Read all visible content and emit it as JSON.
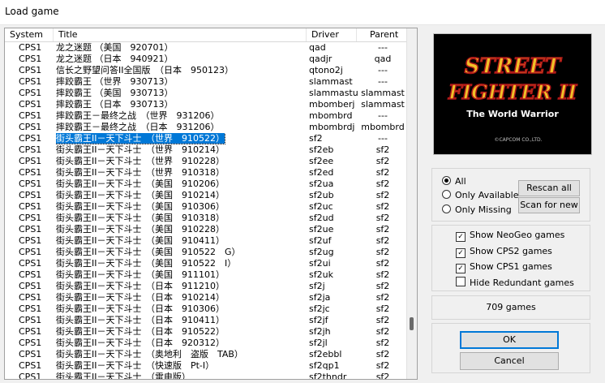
{
  "window": {
    "title": "Load game"
  },
  "columns": [
    "System",
    "Title",
    "Driver",
    "Parent"
  ],
  "rows": [
    [
      "CPS1",
      "龙之迷题 （美国　920701）",
      "qad",
      "---"
    ],
    [
      "CPS1",
      "龙之迷题 （日本　940921）",
      "qadjr",
      "qad"
    ],
    [
      "CPS1",
      "信长之野望问答II全国版　（日本　950123）",
      "qtono2j",
      "---"
    ],
    [
      "CPS1",
      "摔跤霸王 （世界　930713）",
      "slammast",
      "---"
    ],
    [
      "CPS1",
      "摔跤霸王 （美国　930713）",
      "slammastu",
      "slammast"
    ],
    [
      "CPS1",
      "摔跤霸王 （日本　930713）",
      "mbomberj",
      "slammast"
    ],
    [
      "CPS1",
      "摔跤霸王－最终之战　（世界　931206）",
      "mbombrd",
      "---"
    ],
    [
      "CPS1",
      "摔跤霸王－最终之战　（日本　931206）",
      "mbombrdj",
      "mbombrd"
    ],
    [
      "CPS1",
      "街头霸王II－天下斗士　（世界　910522）",
      "sf2",
      "---"
    ],
    [
      "CPS1",
      "街头霸王II－天下斗士　（世界　910214）",
      "sf2eb",
      "sf2"
    ],
    [
      "CPS1",
      "街头霸王II－天下斗士　（世界　910228）",
      "sf2ee",
      "sf2"
    ],
    [
      "CPS1",
      "街头霸王II－天下斗士　（世界　910318）",
      "sf2ed",
      "sf2"
    ],
    [
      "CPS1",
      "街头霸王II－天下斗士　（美国　910206）",
      "sf2ua",
      "sf2"
    ],
    [
      "CPS1",
      "街头霸王II－天下斗士　（美国　910214）",
      "sf2ub",
      "sf2"
    ],
    [
      "CPS1",
      "街头霸王II－天下斗士　（美国　910306）",
      "sf2uc",
      "sf2"
    ],
    [
      "CPS1",
      "街头霸王II－天下斗士　（美国　910318）",
      "sf2ud",
      "sf2"
    ],
    [
      "CPS1",
      "街头霸王II－天下斗士　（美国　910228）",
      "sf2ue",
      "sf2"
    ],
    [
      "CPS1",
      "街头霸王II－天下斗士　（美国　910411）",
      "sf2uf",
      "sf2"
    ],
    [
      "CPS1",
      "街头霸王II－天下斗士　（美国　910522　G）",
      "sf2ug",
      "sf2"
    ],
    [
      "CPS1",
      "街头霸王II－天下斗士　（美国　910522　I）",
      "sf2ui",
      "sf2"
    ],
    [
      "CPS1",
      "街头霸王II－天下斗士　（美国　911101）",
      "sf2uk",
      "sf2"
    ],
    [
      "CPS1",
      "街头霸王II－天下斗士　（日本　911210）",
      "sf2j",
      "sf2"
    ],
    [
      "CPS1",
      "街头霸王II－天下斗士　（日本　910214）",
      "sf2ja",
      "sf2"
    ],
    [
      "CPS1",
      "街头霸王II－天下斗士　（日本　910306）",
      "sf2jc",
      "sf2"
    ],
    [
      "CPS1",
      "街头霸王II－天下斗士　（日本　910411）",
      "sf2jf",
      "sf2"
    ],
    [
      "CPS1",
      "街头霸王II－天下斗士　（日本　910522）",
      "sf2jh",
      "sf2"
    ],
    [
      "CPS1",
      "街头霸王II－天下斗士　（日本　920312）",
      "sf2jl",
      "sf2"
    ],
    [
      "CPS1",
      "街头霸王II－天下斗士　（奥地利　盗版　TAB）",
      "sf2ebbl",
      "sf2"
    ],
    [
      "CPS1",
      "街头霸王II－天下斗士　（快速版　Pt-I）",
      "sf2qp1",
      "sf2"
    ],
    [
      "CPS1",
      "街头霸王II－天下斗士　（雷电版）",
      "sf2thndr",
      "sf2"
    ]
  ],
  "selected_row": 8,
  "preview": {
    "line1": "STREET",
    "line2": "FIGHTER II",
    "subtitle": "The World Warrior",
    "credit": "©CAPCOM CO.,LTD."
  },
  "filter": {
    "all": "All",
    "only_available": "Only Available",
    "only_missing": "Only Missing",
    "rescan_all": "Rescan all",
    "scan_new": "Scan for new"
  },
  "options": {
    "neogeo": "Show NeoGeo games",
    "cps2": "Show CPS2 games",
    "cps1": "Show CPS1 games",
    "redundant": "Hide Redundant games"
  },
  "count_text": "709 games",
  "ok": "OK",
  "cancel": "Cancel"
}
